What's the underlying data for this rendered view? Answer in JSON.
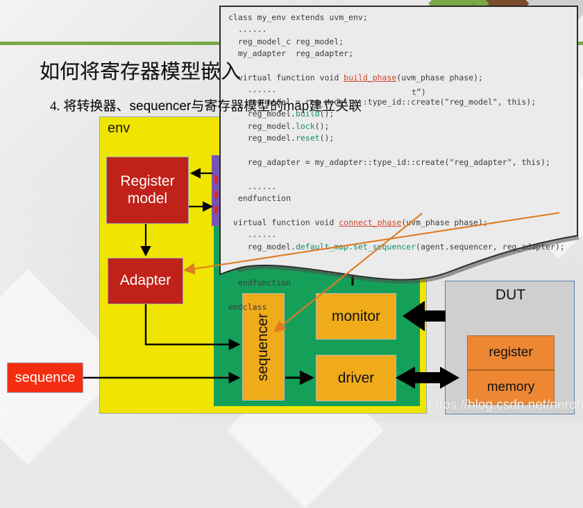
{
  "slide": {
    "title": "如何将寄存器模型嵌入",
    "bullet_number": "4.",
    "bullet_text": "将转换器、sequencer与寄存器模型的map建立关联",
    "watermark": "https://blog.csdn.net/nerohero"
  },
  "diagram": {
    "env_label": "env",
    "register_model": "Register\nmodel",
    "register_model_line1": "Register",
    "register_model_line2": "model",
    "adapter": "Adapter",
    "sequence": "sequence",
    "sequencer": "sequencer",
    "monitor": "monitor",
    "driver": "driver",
    "dut_title": "DUT",
    "dut_register": "register",
    "dut_memory": "memory"
  },
  "code": {
    "lines": [
      "class my_env extends uvm_env;",
      "  ......",
      "  reg_model_c reg_model;",
      "  my_adapter  reg_adapter;",
      "",
      "  virtual function void build_phase(uvm_phase phase);",
      "    ......",
      "    reg_model = reg_model_c::type_id::create(\"reg_model\", this);",
      "    reg_model.build();",
      "    reg_model.lock();",
      "    reg_model.reset();",
      "",
      "    reg_adapter = my_adapter::type_id::create(\"reg_adapter\", this);",
      "",
      "    ......",
      "  endfunction",
      "",
      " virtual function void connect_phase(uvm_phase phase);",
      "    ......",
      "    reg_model.default_map.set_sequencer(agent.sequencer, reg_adapter);",
      "",
      "",
      "  endfunction",
      "",
      "endclass"
    ],
    "fragment_overlap": "t”)",
    "keywords_red": [
      "build_phase",
      "connect_phase"
    ],
    "keywords_green": [
      "lock",
      "reset",
      "default_map",
      "set_sequencer"
    ]
  },
  "colors": {
    "env_yellow": "#efe500",
    "agent_green": "#15a05a",
    "red_box": "#c02118",
    "sequence_red": "#f42d10",
    "orange_box": "#f0ab1b",
    "dut_gray": "#cfcfcf",
    "dut_cell_orange": "#ed8733",
    "predictor_purple": "#7755b5",
    "pred_mark_red": "#e8251f",
    "callout_arrow": "#e07b20",
    "rule_green": "#7aa845",
    "corner_brown": "#7b4b2a",
    "background": "#e4e4e4"
  }
}
